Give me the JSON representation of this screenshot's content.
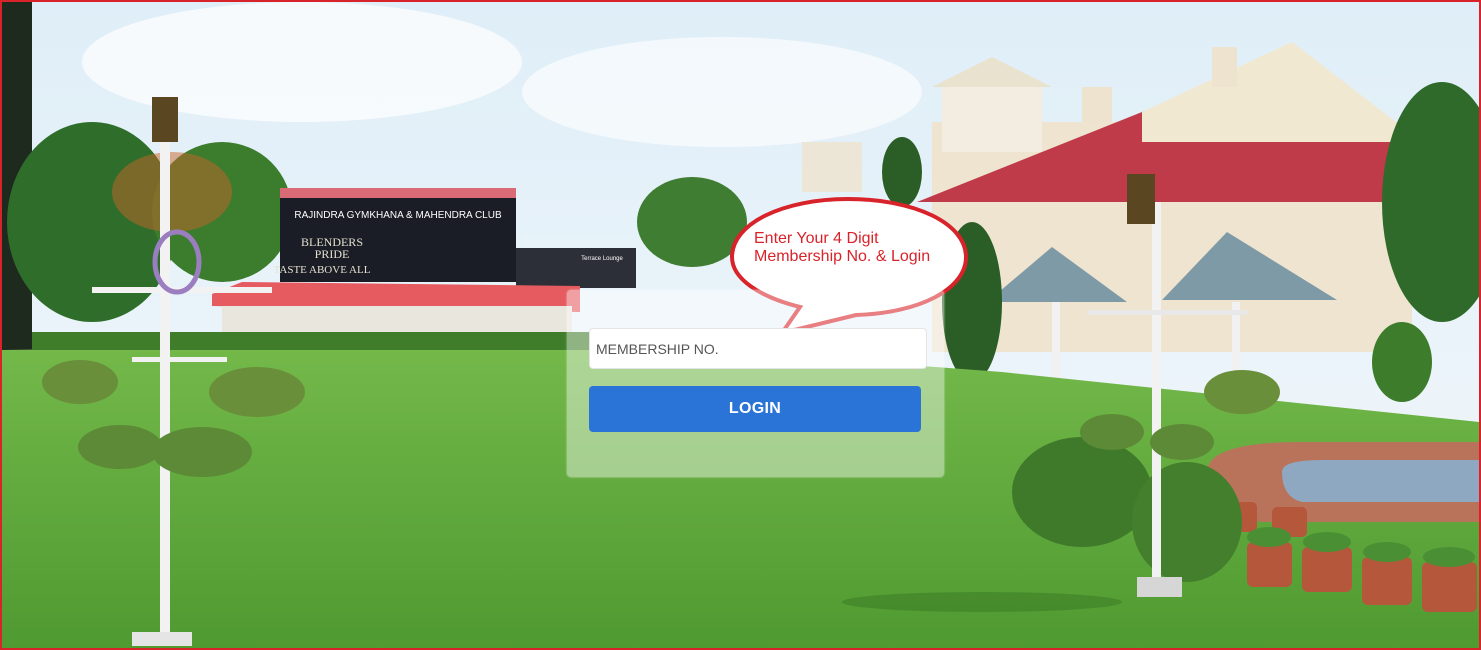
{
  "background": {
    "club_sign_line1": "RAJINDRA GYMKHANA & MAHENDRA CLUB",
    "billboard_line1": "BLENDERS",
    "billboard_line2": "PRIDE",
    "billboard_line3": "TASTE ABOVE ALL",
    "lounge_sign": "Terrace Lounge"
  },
  "tooltip": {
    "line1": "Enter Your 4 Digit",
    "line2": "Membership No. & Login"
  },
  "login": {
    "membership_placeholder": "MEMBERSHIP NO.",
    "membership_value": "",
    "button_label": "LOGIN"
  },
  "colors": {
    "accent_red": "#d8232a",
    "button_blue": "#2a73d7",
    "lawn_green": "#5faa3e"
  }
}
